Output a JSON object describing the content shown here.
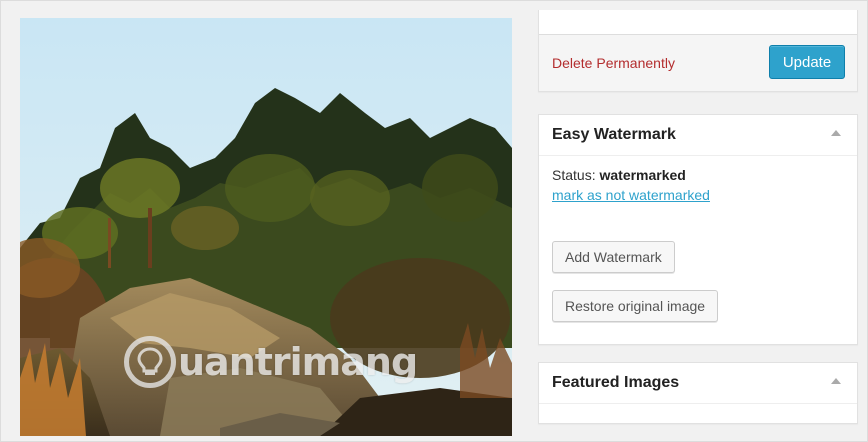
{
  "publish": {
    "delete_label": "Delete Permanently",
    "update_label": "Update"
  },
  "easy_watermark": {
    "title": "Easy Watermark",
    "status_label": "Status:",
    "status_value": "watermarked",
    "unmark_link": "mark as not watermarked",
    "add_button": "Add Watermark",
    "restore_button": "Restore original image"
  },
  "featured_images": {
    "title": "Featured Images"
  },
  "image": {
    "watermark_text": "uantrimang",
    "watermark_logo": "lightbulb-icon"
  },
  "colors": {
    "update_button": "#2ea2cc",
    "delete_link": "#b32d2e",
    "link": "#2ea2cc"
  }
}
